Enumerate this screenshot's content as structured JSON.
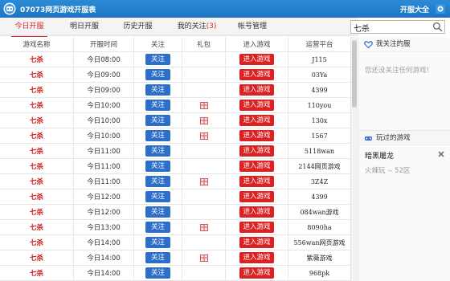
{
  "app": {
    "title": "07073网页游戏开服表",
    "right_link": "开服大全",
    "logo_icon": "game-robot-logo",
    "settings_icon": "gear-icon",
    "accent": "#1f7cc8"
  },
  "tabs": [
    {
      "label": "今日开服",
      "active": true
    },
    {
      "label": "明日开服",
      "active": false
    },
    {
      "label": "历史开服",
      "active": false
    },
    {
      "label": "我的关注",
      "count": "(3)",
      "active": false
    },
    {
      "label": "帐号管理",
      "active": false
    }
  ],
  "search": {
    "value": "七杀"
  },
  "table": {
    "headers": [
      "游戏名称",
      "开服时间",
      "关注",
      "礼包",
      "进入游戏",
      "运营平台"
    ],
    "follow_label": "关注",
    "enter_label": "进入游戏",
    "rows": [
      {
        "game": "七杀",
        "time": "今日08:00",
        "gift": false,
        "platform": "J115"
      },
      {
        "game": "七杀",
        "time": "今日09:00",
        "gift": false,
        "platform": "03Ya"
      },
      {
        "game": "七杀",
        "time": "今日09:00",
        "gift": false,
        "platform": "4399"
      },
      {
        "game": "七杀",
        "time": "今日10:00",
        "gift": true,
        "platform": "110you"
      },
      {
        "game": "七杀",
        "time": "今日10:00",
        "gift": true,
        "platform": "130x"
      },
      {
        "game": "七杀",
        "time": "今日10:00",
        "gift": true,
        "platform": "1567"
      },
      {
        "game": "七杀",
        "time": "今日11:00",
        "gift": false,
        "platform": "5118wan"
      },
      {
        "game": "七杀",
        "time": "今日11:00",
        "gift": false,
        "platform": "2144网页游戏"
      },
      {
        "game": "七杀",
        "time": "今日11:00",
        "gift": true,
        "platform": "3Z4Z"
      },
      {
        "game": "七杀",
        "time": "今日12:00",
        "gift": false,
        "platform": "4399"
      },
      {
        "game": "七杀",
        "time": "今日12:00",
        "gift": false,
        "platform": "084wan游戏"
      },
      {
        "game": "七杀",
        "time": "今日13:00",
        "gift": true,
        "platform": "8090ha"
      },
      {
        "game": "七杀",
        "time": "今日14:00",
        "gift": false,
        "platform": "556wan网页游戏"
      },
      {
        "game": "七杀",
        "time": "今日14:00",
        "gift": true,
        "platform": "紫薇游戏"
      },
      {
        "game": "七杀",
        "time": "今日14:00",
        "gift": false,
        "platform": "968pk"
      }
    ]
  },
  "sidebar": {
    "followed_title": "我关注的服",
    "followed_icon": "heart-icon",
    "followed_empty": "您还没关注任何游戏！",
    "played_title": "玩过的游戏",
    "played_icon": "gamepad-icon",
    "played_game": "暗黑屠龙",
    "played_server": "火辣玩 -- 52区",
    "remove_icon": "close-icon"
  }
}
